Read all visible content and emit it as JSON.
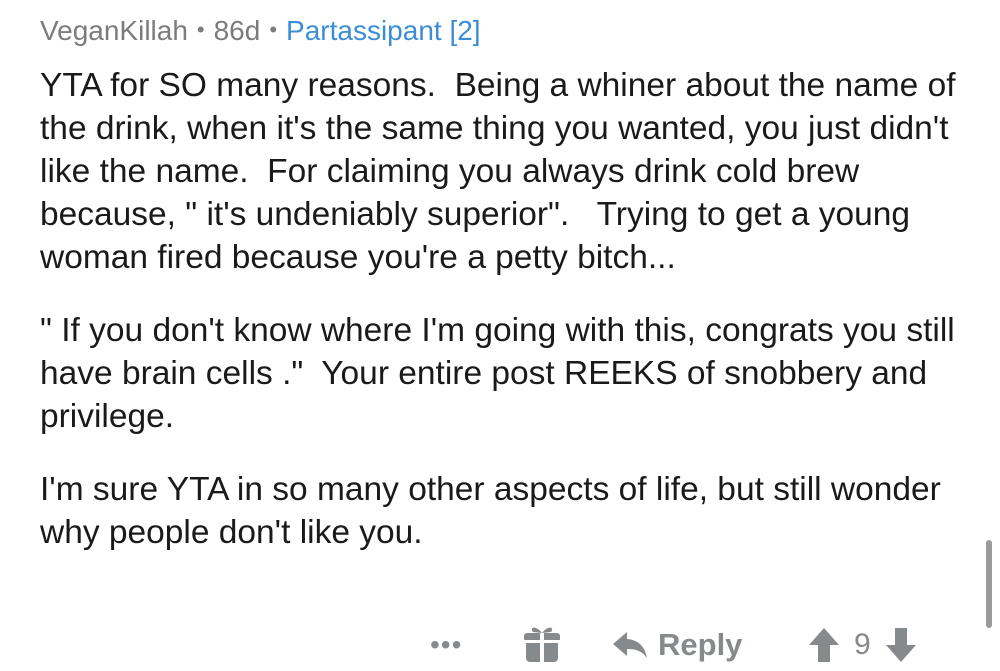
{
  "comment": {
    "author": "VeganKillah",
    "age": "86d",
    "flair": "Partassipant [2]",
    "separator": "•",
    "paragraphs": [
      "YTA for SO many reasons.  Being a whiner about the name of the drink, when it's the same thing you wanted, you just didn't like the name.  For claiming you always drink cold brew because, \" it's undeniably superior\".   Trying to get a young woman fired because you're a petty bitch...",
      "\" If you don't know where I'm going with this, congrats you still have brain cells .\"  Your entire post REEKS of snobbery and privilege.",
      "I'm sure YTA in so many other aspects of life, but still wonder why people don't like you."
    ]
  },
  "actions": {
    "more_label": "•••",
    "reply_label": "Reply",
    "score": "9"
  },
  "icons": {
    "more": "more-options-icon",
    "gift": "gift-award-icon",
    "reply": "reply-arrow-icon",
    "upvote": "upvote-arrow-icon",
    "downvote": "downvote-arrow-icon"
  },
  "colors": {
    "text": "#1a1a1b",
    "meta": "#7c7c7c",
    "flair": "#3b8ed6",
    "icon": "#878a8c"
  }
}
